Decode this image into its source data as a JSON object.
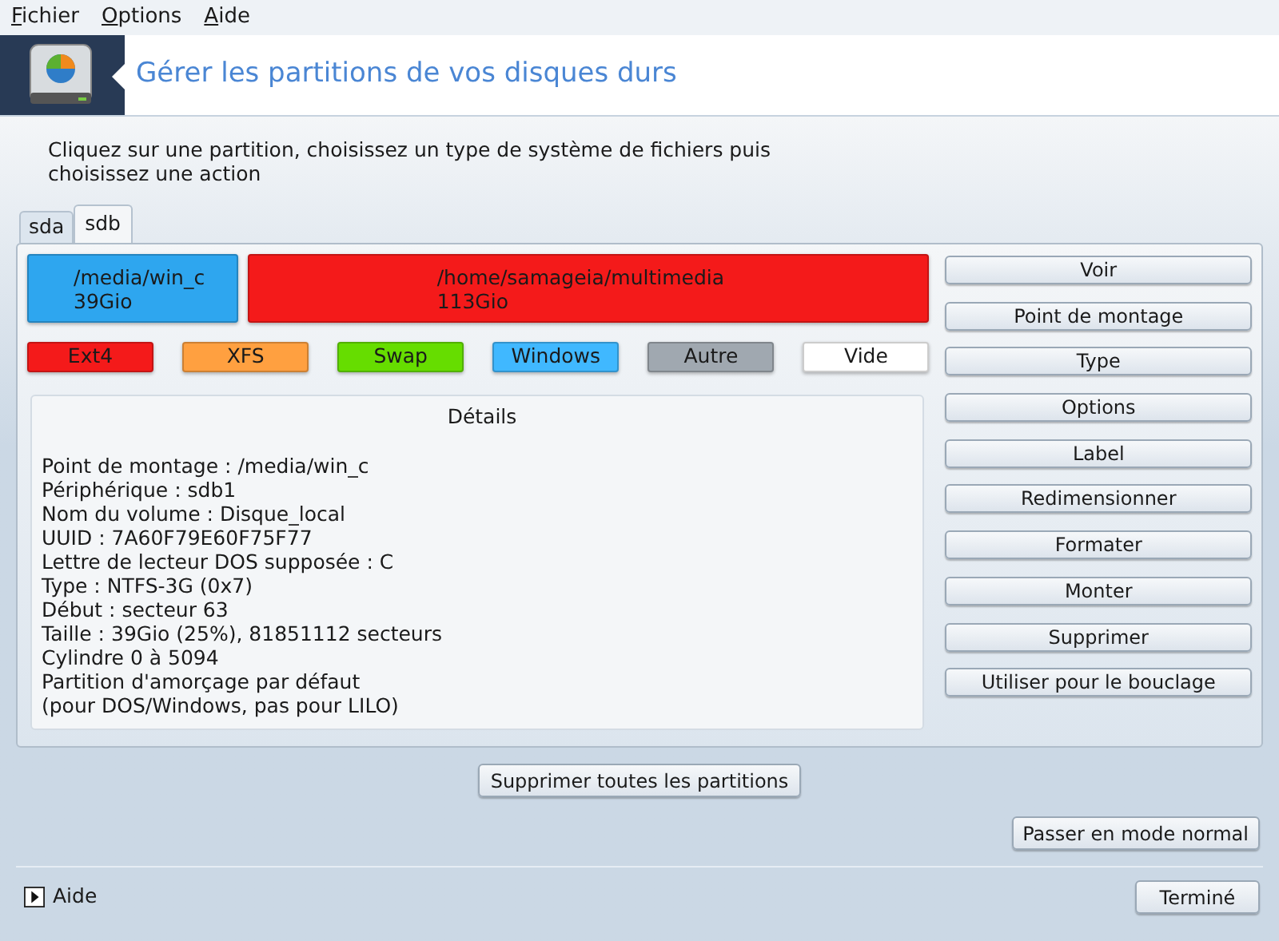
{
  "menu": [
    "Fichier",
    "Options",
    "Aide"
  ],
  "header": {
    "title": "Gérer les partitions de vos disques durs"
  },
  "description": "Cliquez sur une partition, choisissez un type de système de fichiers puis choisissez une action",
  "tabs": [
    {
      "label": "sda",
      "selected": false
    },
    {
      "label": "sdb",
      "selected": true
    }
  ],
  "partitions": [
    {
      "mount": "/media/win_c",
      "size": "39Gio",
      "color": "#2ea6ef"
    },
    {
      "mount": "/home/samageia/multimedia",
      "size": "113Gio",
      "color": "#f41a1a"
    }
  ],
  "legend": [
    {
      "label": "Ext4",
      "color": "#f41a1a"
    },
    {
      "label": "XFS",
      "color": "#ffa040"
    },
    {
      "label": "Swap",
      "color": "#66dd00"
    },
    {
      "label": "Windows",
      "color": "#40b8ff"
    },
    {
      "label": "Autre",
      "color": "#a0a8b0"
    },
    {
      "label": "Vide",
      "color": "#ffffff"
    }
  ],
  "details": {
    "title": "Détails",
    "lines": [
      "Point de montage : /media/win_c",
      "Périphérique : sdb1",
      "Nom du volume : Disque_local",
      "UUID : 7A60F79E60F75F77",
      "Lettre de lecteur DOS supposée : C",
      "Type : NTFS-3G (0x7)",
      "Début : secteur 63",
      "Taille : 39Gio (25%), 81851112 secteurs",
      "Cylindre 0 à 5094",
      "Partition d'amorçage par défaut",
      "(pour DOS/Windows, pas pour LILO)"
    ]
  },
  "actions": [
    "Voir",
    "Point de montage",
    "Type",
    "Options",
    "Label",
    "Redimensionner",
    "Formater",
    "Monter",
    "Supprimer",
    "Utiliser pour le bouclage"
  ],
  "delete_all_button": "Supprimer toutes les partitions",
  "mode_button": "Passer en mode normal",
  "help": {
    "label": "Aide",
    "expanded": false
  },
  "done_button": "Terminé"
}
